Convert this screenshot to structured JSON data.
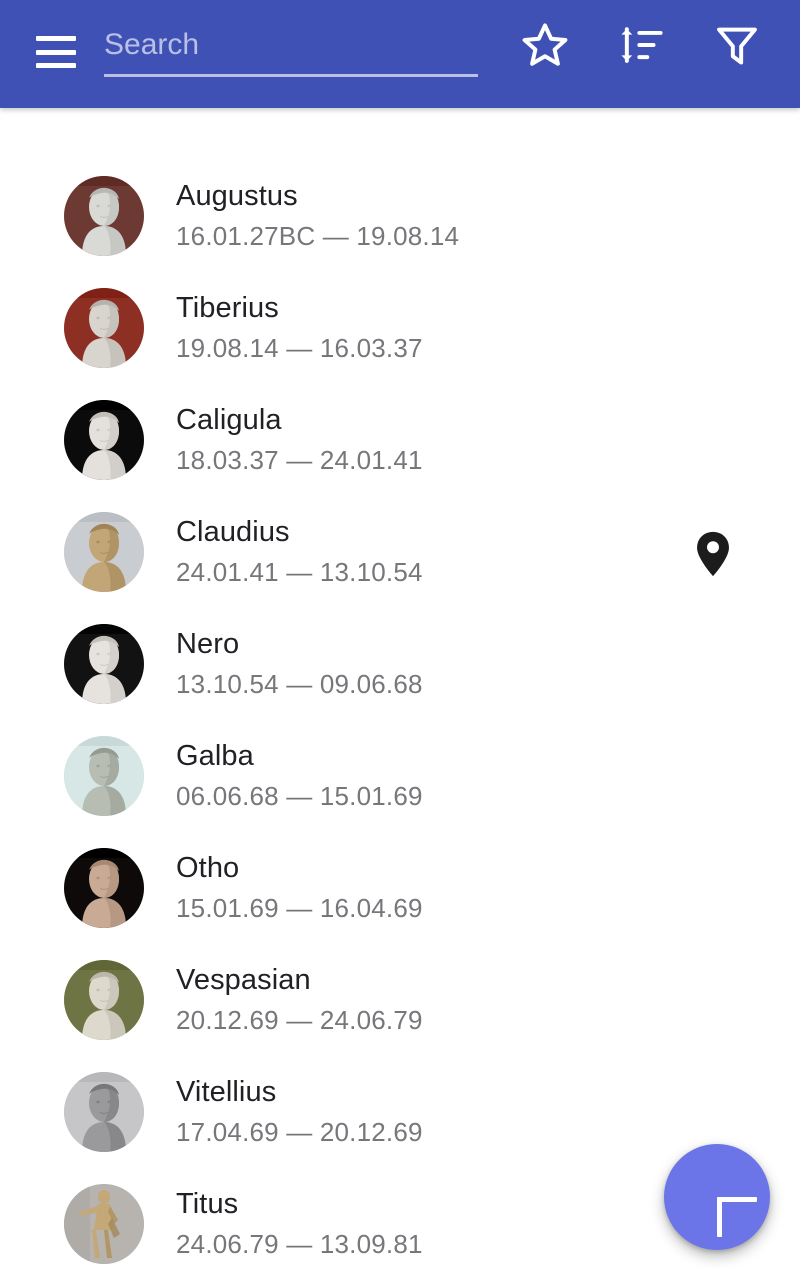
{
  "toolbar": {
    "menu_icon": "hamburger-menu-icon",
    "search": {
      "placeholder": "Search",
      "value": ""
    },
    "actions": [
      {
        "name": "favorites",
        "icon": "star-outline-icon",
        "label": "Favorites"
      },
      {
        "name": "sort",
        "icon": "sort-icon",
        "label": "Sort"
      },
      {
        "name": "filter",
        "icon": "funnel-filter-icon",
        "label": "Filter"
      }
    ],
    "background_color": "#3f51b5"
  },
  "overlay": {
    "map_pin": {
      "icon": "map-pin-icon",
      "color": "#1c1c1c"
    }
  },
  "fab": {
    "icon": "plus-icon",
    "label": "Add",
    "color": "#6c75e8"
  },
  "list": {
    "items": [
      {
        "name": "Augustus",
        "dates": "16.01.27BC — 19.08.14",
        "avatar": {
          "bg": "#6d3a33",
          "figure": "#d9d9d6",
          "kind": "bust"
        }
      },
      {
        "name": "Tiberius",
        "dates": "19.08.14 — 16.03.37",
        "avatar": {
          "bg": "#8e2f24",
          "figure": "#d8d5cf",
          "kind": "bust"
        }
      },
      {
        "name": "Caligula",
        "dates": "18.03.37 — 24.01.41",
        "avatar": {
          "bg": "#0b0b0b",
          "figure": "#e4e1dc",
          "kind": "bust"
        }
      },
      {
        "name": "Claudius",
        "dates": "24.01.41 — 13.10.54",
        "avatar": {
          "bg": "#c9cdd2",
          "figure": "#c2a678",
          "kind": "bust"
        }
      },
      {
        "name": "Nero",
        "dates": "13.10.54 — 09.06.68",
        "avatar": {
          "bg": "#121212",
          "figure": "#e6e3de",
          "kind": "bust"
        }
      },
      {
        "name": "Galba",
        "dates": "06.06.68 — 15.01.69",
        "avatar": {
          "bg": "#d6e7e6",
          "figure": "#b7bdb2",
          "kind": "bust"
        }
      },
      {
        "name": "Otho",
        "dates": "15.01.69 — 16.04.69",
        "avatar": {
          "bg": "#0d0a09",
          "figure": "#c9ab95",
          "kind": "bust"
        }
      },
      {
        "name": "Vespasian",
        "dates": "20.12.69 — 24.06.79",
        "avatar": {
          "bg": "#6f7445",
          "figure": "#ddd9cd",
          "kind": "bust"
        }
      },
      {
        "name": "Vitellius",
        "dates": "17.04.69 — 20.12.69",
        "avatar": {
          "bg": "#c6c6c8",
          "figure": "#9a9a9c",
          "kind": "bust"
        }
      },
      {
        "name": "Titus",
        "dates": "24.06.79 — 13.09.81",
        "avatar": {
          "bg": "#b7b3ae",
          "figure": "#c4a878",
          "kind": "statue"
        }
      }
    ]
  }
}
